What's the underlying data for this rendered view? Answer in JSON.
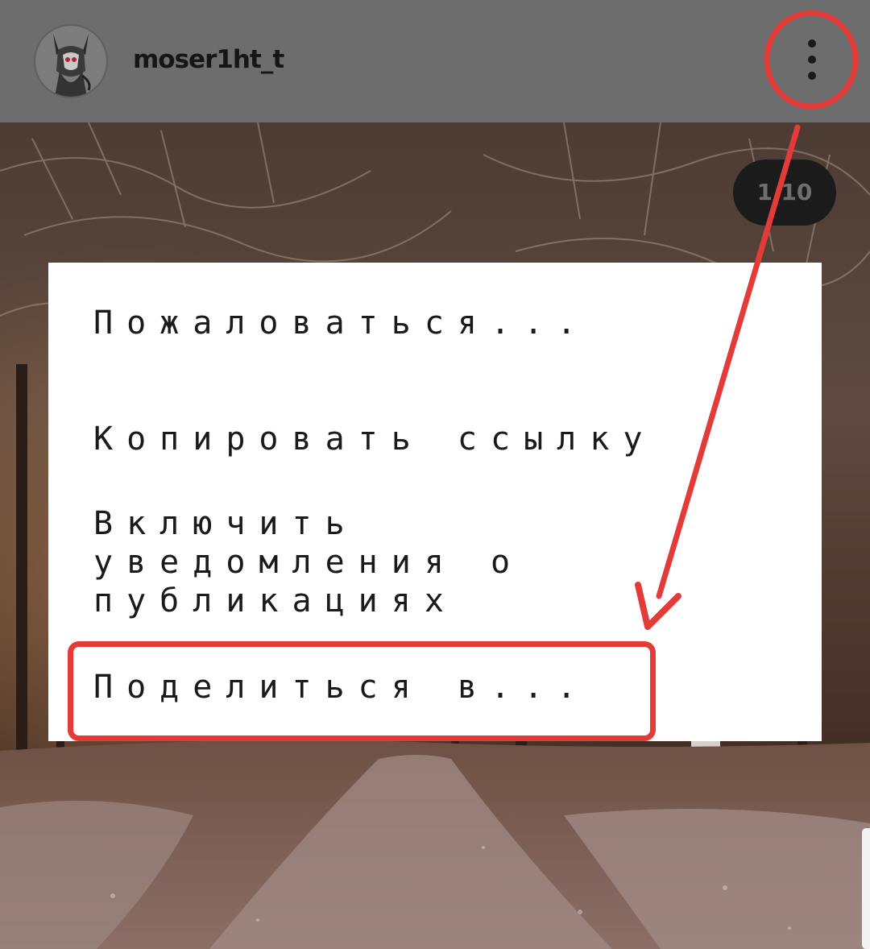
{
  "header": {
    "username": "moser1ht_t",
    "avatar_icon": "demon-avatar-icon",
    "more_icon": "more-vertical-icon"
  },
  "photo": {
    "counter": "1/10",
    "scene": "winter-park-photo"
  },
  "menu": {
    "items": [
      {
        "label": "Пожаловаться..."
      },
      {
        "label": "Копировать ссылку"
      },
      {
        "label": "Включить уведомления о публикациях"
      },
      {
        "label": "Поделиться в..."
      }
    ]
  },
  "annotations": {
    "color": "#e23b38"
  }
}
